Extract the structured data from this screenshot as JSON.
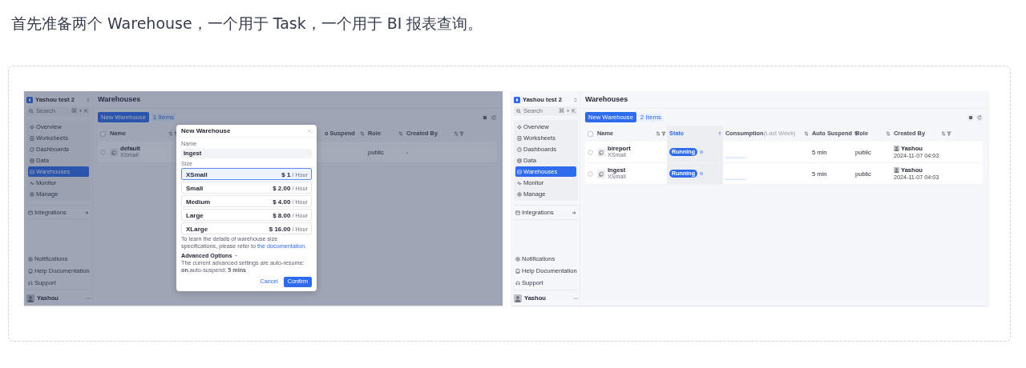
{
  "intro": "首先准备两个 Warehouse，一个用于 Task，一个用于 BI 报表查询。",
  "screens": [
    {
      "dimmed": true,
      "sidebar": {
        "workspace": "Yashou test 2",
        "search": {
          "placeholder": "Search",
          "shortcut": "⌘ + K"
        },
        "nav": [
          {
            "label": "Overview",
            "selected": false
          },
          {
            "label": "Worksheets",
            "selected": false
          },
          {
            "label": "Dashboards",
            "selected": false
          },
          {
            "label": "Data",
            "selected": false
          },
          {
            "label": "Warehouses",
            "selected": true
          },
          {
            "label": "Monitor",
            "selected": false
          },
          {
            "label": "Manage",
            "selected": false
          }
        ],
        "integrations": "Integrations",
        "links": [
          "Notifications",
          "Help Documentation",
          "Support"
        ],
        "user": "Yashou"
      },
      "title": "Warehouses",
      "new_button": "New Warehouse",
      "count": "1 Items",
      "columns": [
        {
          "kind": "name",
          "label": "Name"
        },
        {
          "kind": "suspend",
          "label": "o Suspend"
        },
        {
          "kind": "role",
          "label": "Role"
        },
        {
          "kind": "creator",
          "label": "Created By"
        }
      ],
      "all_checked": false,
      "rows": [
        {
          "checked": false,
          "name": "default",
          "size": "XSmall",
          "role": "public",
          "creator": "-"
        }
      ],
      "dialog": {
        "title": "New Warehouse",
        "name_label": "Name",
        "name_value": "Ingest",
        "size_label": "Size",
        "sizes": [
          {
            "label": "XSmall",
            "price": "$ 1",
            "unit": "/ Hour",
            "selected": true
          },
          {
            "label": "Small",
            "price": "$ 2.00",
            "unit": "/ Hour",
            "selected": false
          },
          {
            "label": "Medium",
            "price": "$ 4.00",
            "unit": "/ Hour",
            "selected": false
          },
          {
            "label": "Large",
            "price": "$ 8.00",
            "unit": "/ Hour",
            "selected": false
          },
          {
            "label": "XLarge",
            "price": "$ 16.00",
            "unit": "/ Hour",
            "selected": false
          }
        ],
        "note": "To learn the details of warehouse size specifications, please refer to",
        "link": "the documentation.",
        "advanced": "Advanced Options",
        "settings": "The current advanced settings are auto-resume: **on**,auto-suspend: **5 mins**",
        "cancel": "Cancel",
        "confirm": "Confirm"
      }
    },
    {
      "dimmed": false,
      "sidebar": {
        "workspace": "Yashou test 2",
        "search": {
          "placeholder": "Search",
          "shortcut": "⌘ + K"
        },
        "nav": [
          {
            "label": "Overview",
            "selected": false
          },
          {
            "label": "Worksheets",
            "selected": false
          },
          {
            "label": "Dashboards",
            "selected": false
          },
          {
            "label": "Data",
            "selected": false
          },
          {
            "label": "Warehouses",
            "selected": true
          },
          {
            "label": "Monitor",
            "selected": false
          },
          {
            "label": "Manage",
            "selected": false
          }
        ],
        "integrations": "Integrations",
        "links": [
          "Notifications",
          "Help Documentation",
          "Support"
        ],
        "user": "Yashou"
      },
      "title": "Warehouses",
      "new_button": "New Warehouse",
      "count": "2 Items",
      "columns": [
        {
          "kind": "name",
          "label": "Name"
        },
        {
          "kind": "state",
          "label": "State",
          "sorted": true
        },
        {
          "kind": "consumption",
          "label": "Consumption",
          "note": "(Last Week)"
        },
        {
          "kind": "suspend",
          "label": "Auto Suspend"
        },
        {
          "kind": "role",
          "label": "Role"
        },
        {
          "kind": "creator",
          "label": "Created By"
        }
      ],
      "all_checked": false,
      "rows": [
        {
          "checked": false,
          "name": "bireport",
          "size": "XSmall",
          "state": "Running",
          "sparkline": true,
          "suspend": "5 min",
          "role": "public",
          "creator": "Yashou",
          "avatar": true,
          "created": "2024-11-07 04:03"
        },
        {
          "checked": false,
          "name": "Ingest",
          "size": "XSmall",
          "state": "Running",
          "sparkline": true,
          "suspend": "5 min",
          "role": "public",
          "creator": "Yashou",
          "avatar": true,
          "created": "2024-11-07 04:03"
        }
      ]
    }
  ]
}
